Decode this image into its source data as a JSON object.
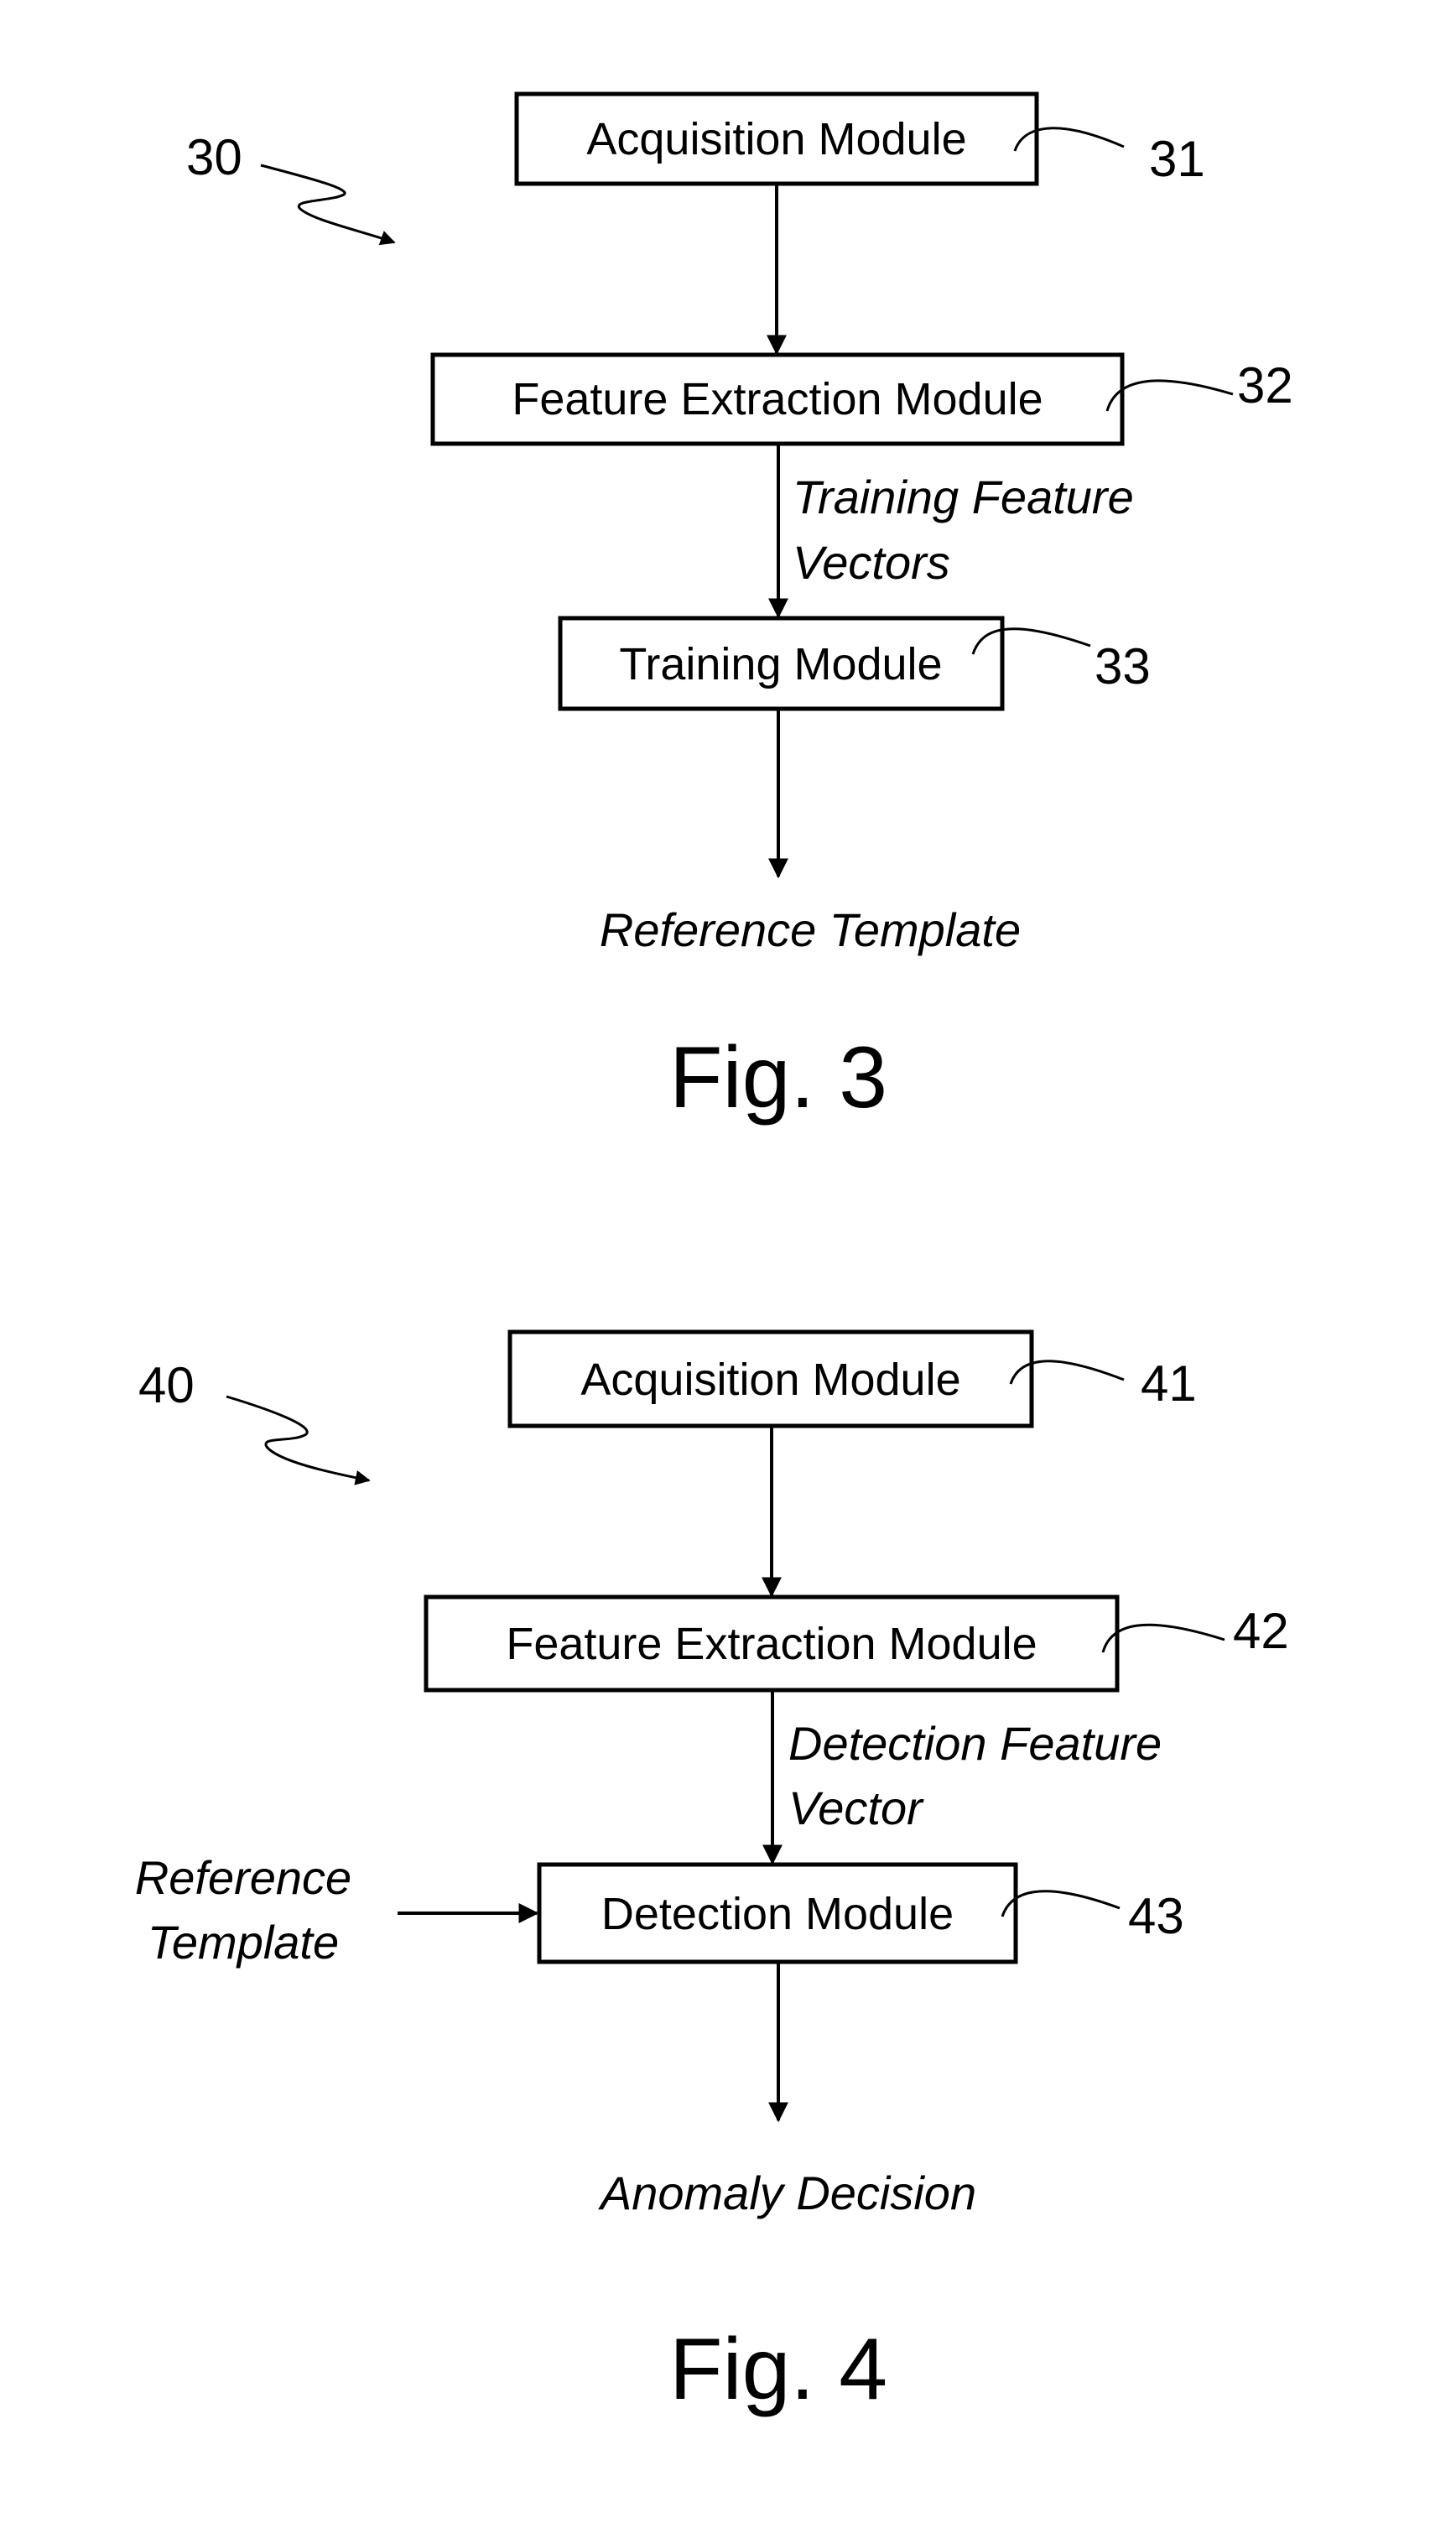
{
  "fig3": {
    "ref": "30",
    "caption": "Fig. 3",
    "boxes": [
      {
        "label": "Acquisition Module",
        "ref": "31"
      },
      {
        "label": "Feature Extraction Module",
        "ref": "32"
      },
      {
        "label": "Training Module",
        "ref": "33"
      }
    ],
    "edge_label_line1": "Training Feature",
    "edge_label_line2": "Vectors",
    "output": "Reference Template"
  },
  "fig4": {
    "ref": "40",
    "caption": "Fig. 4",
    "boxes": [
      {
        "label": "Acquisition Module",
        "ref": "41"
      },
      {
        "label": "Feature Extraction Module",
        "ref": "42"
      },
      {
        "label": "Detection Module",
        "ref": "43"
      }
    ],
    "edge_label_line1": "Detection Feature",
    "edge_label_line2": "Vector",
    "side_input_line1": "Reference",
    "side_input_line2": "Template",
    "output": "Anomaly Decision"
  }
}
